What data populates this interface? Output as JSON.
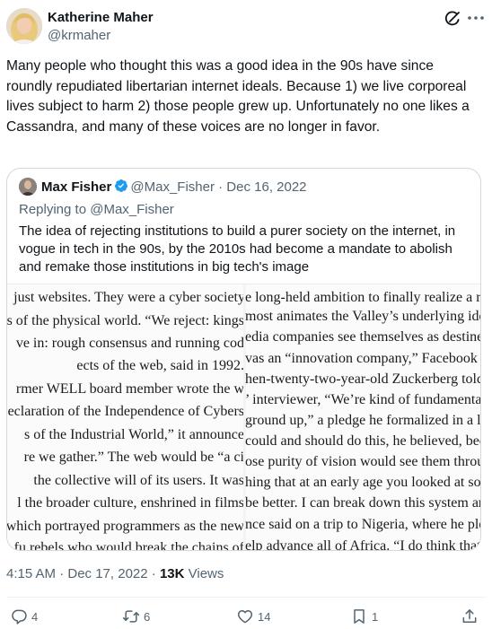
{
  "tweet": {
    "author_name": "Katherine Maher",
    "author_handle": "@krmaher",
    "text": "Many people who thought this was a good idea in the 90s have since roundly repudiated libertarian internet ideals. Because 1) we live corporeal lives subject to harm 2) those people grew up. Unfortunately no one likes a Cassandra, and many of these voices are no longer in favor.",
    "time": "4:15 AM · Dec 17, 2022 · ",
    "views_count": "13K",
    "views_label": " Views"
  },
  "quoted": {
    "name": "Max Fisher",
    "handle_date": "@Max_Fisher · Dec 16, 2022",
    "replying_prefix": "Replying to ",
    "replying_handle": "@Max_Fisher",
    "text": "The idea of rejecting institutions to build a purer society on the internet, in vogue in tech in the 90s, by the 2010s had become a mandate to abolish and remake those institutions in big tech's image",
    "book_left_lines": [
      "just websites. They were a cyber society",
      "s of the physical world. “We reject: kings",
      "ve in: rough consensus and running cod",
      "ects of the web, said in 1992.",
      "rmer WELL board member wrote the w",
      "eclaration of the Independence of Cybers",
      "s of the Industrial World,” it announce",
      "re we gather.” The web would be “a ci",
      " the collective will of its users. It was",
      "l the broader culture, enshrined in films",
      "which portrayed programmers as the new",
      "fu rebels who would break the chains of"
    ],
    "book_right_lines": [
      "e long-held ambition to finally realize a r",
      "most animates the Valley’s underlying ideol",
      "edia companies see themselves as destine",
      "vas an “innovation company,” Facebook wa",
      "hen-twenty-two-year-old Zuckerberg told a",
      "’ interviewer, “We’re kind of fundamentall",
      "ground up,” a pledge he formalized in a lett",
      "could and should do this, he believed, becau",
      "ose purity of vision would see them through",
      "hing that at an early age you looked at som",
      "be better. I can break down this system and",
      "nce said on a trip to Nigeria, where he pled",
      "elp advance all of Africa. “I do think that’s th"
    ]
  },
  "actions": {
    "replies": "4",
    "reposts": "6",
    "likes": "14",
    "bookmarks": "1"
  },
  "colors": {
    "text": "#0f1419",
    "secondary": "#536471",
    "verified": "#1d9bf0",
    "border": "#cfd9de"
  },
  "icons": [
    "grok-icon",
    "more-icon",
    "verified-badge-icon",
    "reply-icon",
    "repost-icon",
    "like-icon",
    "bookmark-icon",
    "share-icon"
  ]
}
